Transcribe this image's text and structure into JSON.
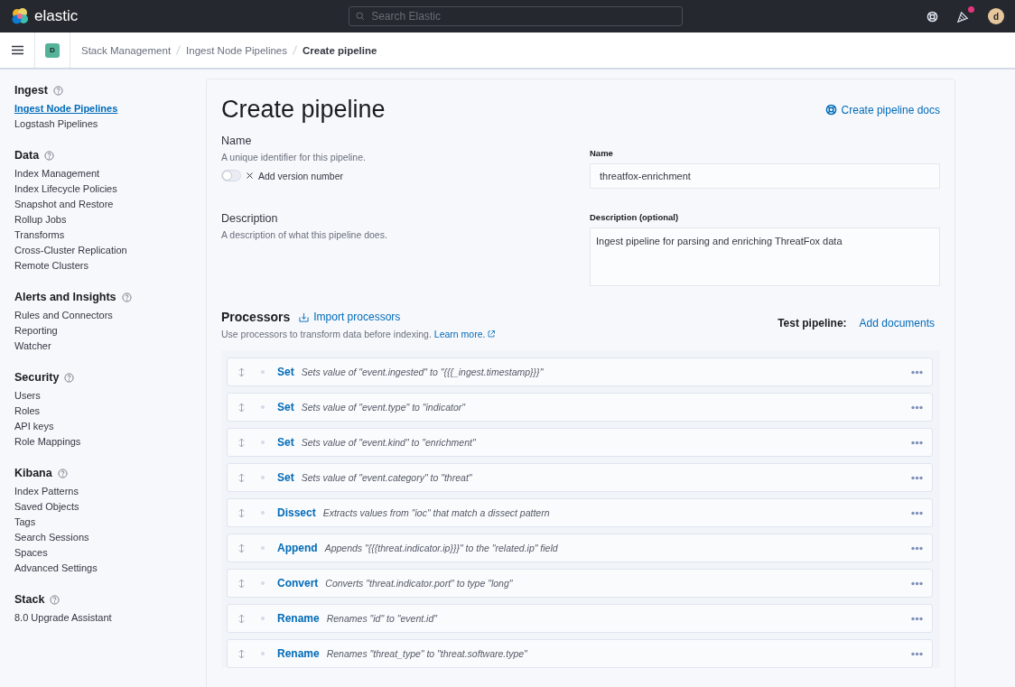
{
  "header": {
    "logo_text": "elastic",
    "search": {
      "placeholder": "Search Elastic"
    },
    "avatar": "d",
    "notification": true
  },
  "breadcrumbs": {
    "space": "D",
    "items": [
      {
        "label": "Stack Management",
        "current": false
      },
      {
        "label": "Ingest Node Pipelines",
        "current": false
      },
      {
        "label": "Create pipeline",
        "current": true
      }
    ]
  },
  "sidebar": {
    "sections": [
      {
        "title": "Ingest",
        "items": [
          {
            "label": "Ingest Node Pipelines",
            "selected": true
          },
          {
            "label": "Logstash Pipelines",
            "selected": false
          }
        ]
      },
      {
        "title": "Data",
        "items": [
          {
            "label": "Index Management",
            "selected": false
          },
          {
            "label": "Index Lifecycle Policies",
            "selected": false
          },
          {
            "label": "Snapshot and Restore",
            "selected": false
          },
          {
            "label": "Rollup Jobs",
            "selected": false
          },
          {
            "label": "Transforms",
            "selected": false
          },
          {
            "label": "Cross-Cluster Replication",
            "selected": false
          },
          {
            "label": "Remote Clusters",
            "selected": false
          }
        ]
      },
      {
        "title": "Alerts and Insights",
        "items": [
          {
            "label": "Rules and Connectors",
            "selected": false
          },
          {
            "label": "Reporting",
            "selected": false
          },
          {
            "label": "Watcher",
            "selected": false
          }
        ]
      },
      {
        "title": "Security",
        "items": [
          {
            "label": "Users",
            "selected": false
          },
          {
            "label": "Roles",
            "selected": false
          },
          {
            "label": "API keys",
            "selected": false
          },
          {
            "label": "Role Mappings",
            "selected": false
          }
        ]
      },
      {
        "title": "Kibana",
        "items": [
          {
            "label": "Index Patterns",
            "selected": false
          },
          {
            "label": "Saved Objects",
            "selected": false
          },
          {
            "label": "Tags",
            "selected": false
          },
          {
            "label": "Search Sessions",
            "selected": false
          },
          {
            "label": "Spaces",
            "selected": false
          },
          {
            "label": "Advanced Settings",
            "selected": false
          }
        ]
      },
      {
        "title": "Stack",
        "items": [
          {
            "label": "8.0 Upgrade Assistant",
            "selected": false
          }
        ]
      }
    ]
  },
  "page": {
    "title": "Create pipeline",
    "docs_link": "Create pipeline docs",
    "name_section": {
      "title": "Name",
      "description": "A unique identifier for this pipeline.",
      "version_toggle": {
        "label": "Add version number",
        "on": false
      },
      "field_label": "Name",
      "value": "threatfox-enrichment"
    },
    "description_section": {
      "title": "Description",
      "description": "A description of what this pipeline does.",
      "field_label": "Description (optional)",
      "value": "Ingest pipeline for parsing and enriching ThreatFox data"
    },
    "processors": {
      "title": "Processors",
      "import_link": "Import processors",
      "help": "Use processors to transform data before indexing.",
      "learn_more": "Learn more.",
      "test_label": "Test pipeline:",
      "add_documents": "Add documents",
      "items": [
        {
          "type": "Set",
          "description": "Sets value of \"event.ingested\" to \"{{{_ingest.timestamp}}}\""
        },
        {
          "type": "Set",
          "description": "Sets value of \"event.type\" to \"indicator\""
        },
        {
          "type": "Set",
          "description": "Sets value of \"event.kind\" to \"enrichment\""
        },
        {
          "type": "Set",
          "description": "Sets value of \"event.category\" to \"threat\""
        },
        {
          "type": "Dissect",
          "description": "Extracts values from \"ioc\" that match a dissect pattern"
        },
        {
          "type": "Append",
          "description": "Appends \"{{{threat.indicator.ip}}}\" to the \"related.ip\" field"
        },
        {
          "type": "Convert",
          "description": "Converts \"threat.indicator.port\" to type \"long\""
        },
        {
          "type": "Rename",
          "description": "Renames \"id\" to \"event.id\""
        },
        {
          "type": "Rename",
          "description": "Renames \"threat_type\" to \"threat.software.type\""
        }
      ]
    }
  }
}
